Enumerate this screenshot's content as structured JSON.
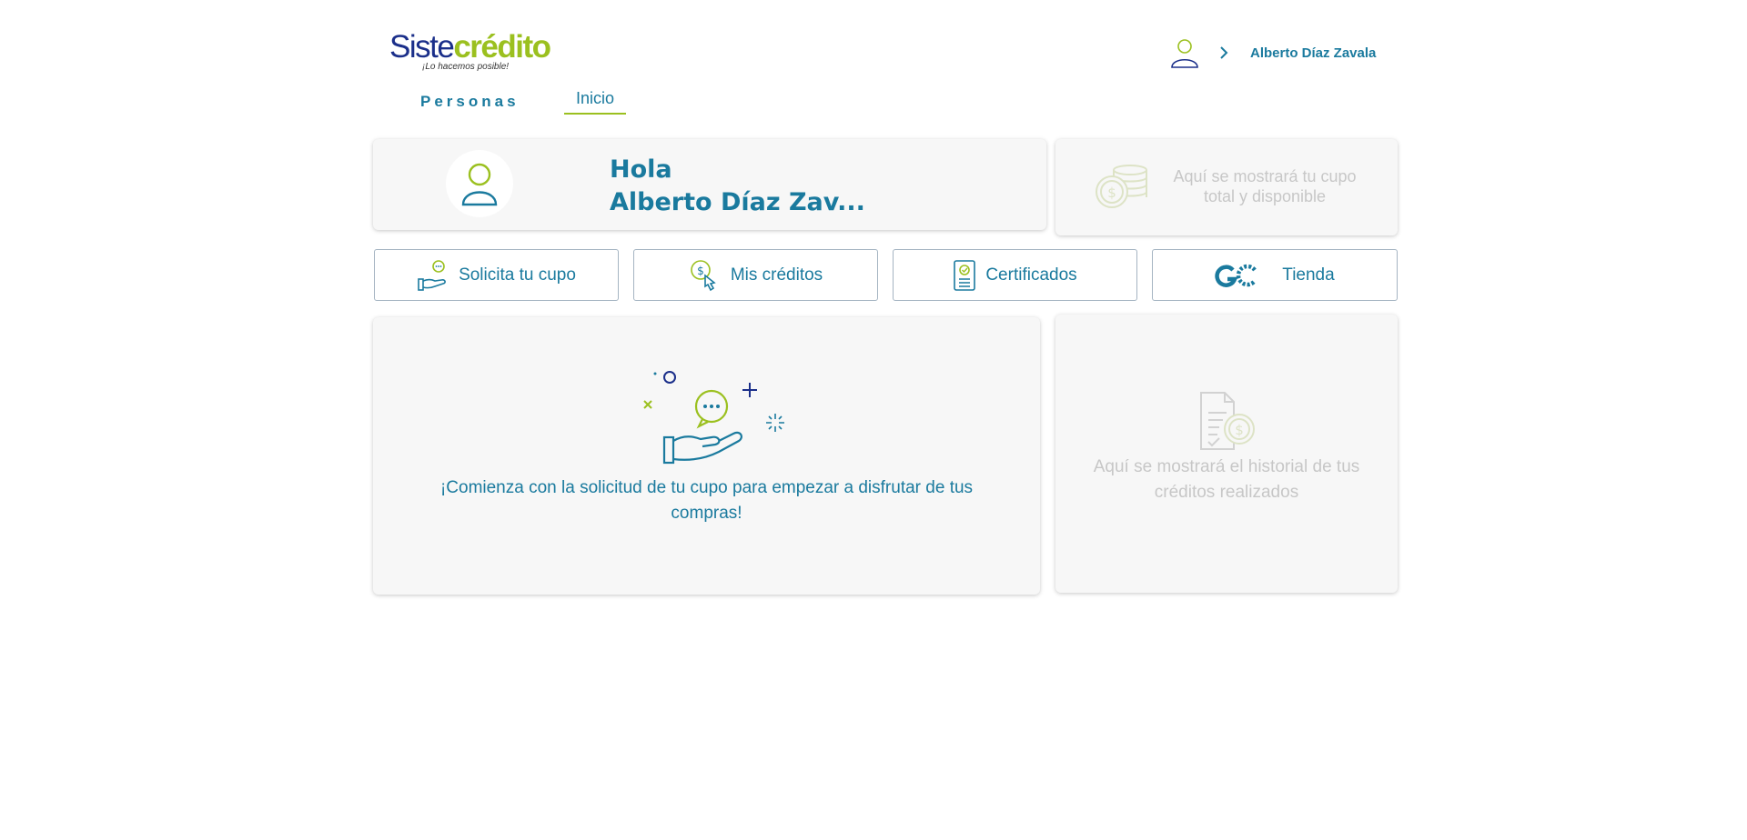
{
  "header": {
    "logo_text_a": "Siste",
    "logo_text_b": "crédito",
    "logo_tagline": "¡Lo hacemos posible!",
    "user_name": "Alberto Díaz Zavala",
    "user_icon": "user-icon",
    "chevron_icon": "chevron-right-icon"
  },
  "nav": {
    "personas_label": "Personas",
    "inicio_label": "Inicio"
  },
  "greeting": {
    "line1": "Hola",
    "line2": "Alberto Díaz Zav..."
  },
  "quota": {
    "placeholder": "Aquí se mostrará tu cupo total y disponible",
    "icon": "coins-icon"
  },
  "actions": [
    {
      "label": "Solicita tu cupo",
      "icon": "hand-chat-icon"
    },
    {
      "label": "Mis créditos",
      "icon": "coin-click-icon"
    },
    {
      "label": "Certificados",
      "icon": "certificate-icon"
    },
    {
      "label": "Tienda",
      "icon": "gc-logo-icon"
    }
  ],
  "start": {
    "message": "¡Comienza con la solicitud de tu cupo para empezar a disfrutar de tus compras!",
    "icon": "hand-chat-illustration"
  },
  "history": {
    "placeholder": "Aquí se mostrará el historial de tus créditos realizados",
    "icon": "document-coin-icon"
  },
  "colors": {
    "primary": "#1a7a9e",
    "accent": "#9bc01f",
    "navy": "#1b2f8a",
    "muted": "#c7c7c7"
  }
}
